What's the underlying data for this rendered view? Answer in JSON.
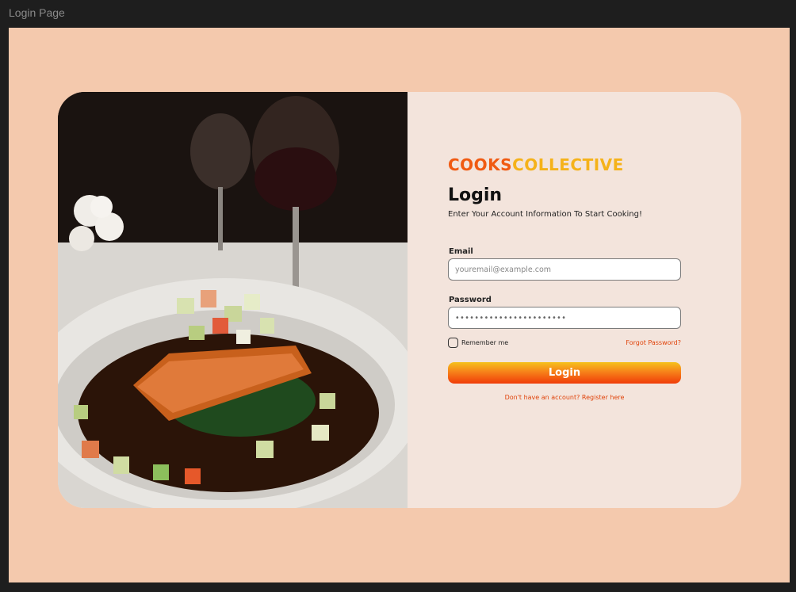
{
  "window": {
    "title": "Login Page"
  },
  "brand": {
    "part1": "COOKS",
    "part2": "COLLECTIVE"
  },
  "login": {
    "title": "Login",
    "subtitle": "Enter Your Account Information To Start Cooking!",
    "email_label": "Email",
    "email_placeholder": "youremail@example.com",
    "password_label": "Password",
    "password_value": "•••••••••••••••••••••••",
    "remember_label": "Remember me",
    "forgot_label": "Forgot Password?",
    "button_label": "Login",
    "register_text": "Don't have an account? Register here"
  },
  "colors": {
    "canvas": "#f4c9ad",
    "panel": "#f3e4dc",
    "brand_primary": "#f05a12",
    "brand_secondary": "#f5b21a",
    "link": "#e0430b"
  },
  "photo": {
    "icon": "food-photo-image"
  }
}
